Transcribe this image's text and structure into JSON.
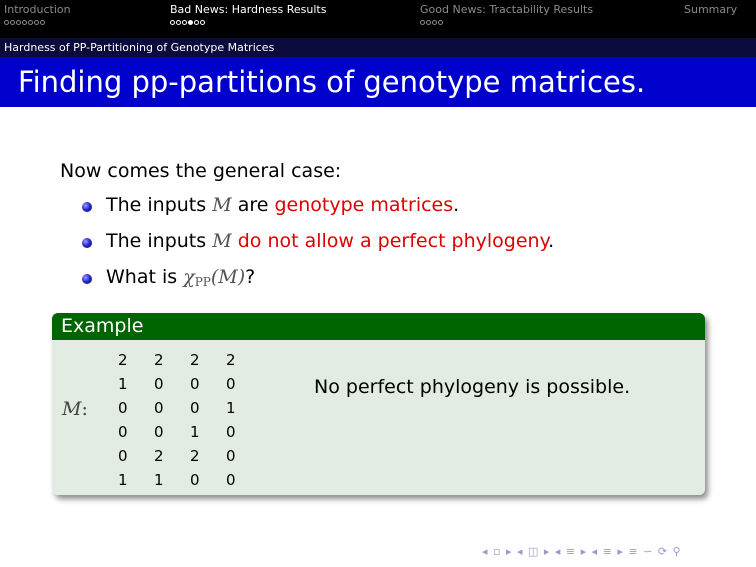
{
  "nav": {
    "sections": [
      {
        "label": "Introduction",
        "dots": 7,
        "filled": -1
      },
      {
        "label": "Bad News: Hardness Results",
        "dots": 6,
        "filled": 3
      },
      {
        "label": "Good News: Tractability Results",
        "dots": 4,
        "filled": -1
      },
      {
        "label": "Summary",
        "dots": 0,
        "filled": -1
      }
    ],
    "active_section": 1
  },
  "subsection": "Hardness of PP-Partitioning of Genotype Matrices",
  "title": "Finding pp-partitions of genotype matrices.",
  "intro": "Now comes the general case:",
  "bullets": [
    {
      "pre": "The inputs",
      "math": "M",
      "mid": "are",
      "red": "genotype matrices",
      "post": "."
    },
    {
      "pre": "The inputs",
      "math": "M",
      "red": "do not allow a perfect phylogeny",
      "post": "."
    },
    {
      "pre": "What is",
      "math_chi": "χ",
      "math_sub": "PP",
      "math_arg": "(M)",
      "post": "?"
    }
  ],
  "example": {
    "header": "Example",
    "matrix_label": "M",
    "matrix_colon": ":",
    "matrix": [
      [
        "2",
        "2",
        "2",
        "2"
      ],
      [
        "1",
        "0",
        "0",
        "0"
      ],
      [
        "0",
        "0",
        "0",
        "1"
      ],
      [
        "0",
        "0",
        "1",
        "0"
      ],
      [
        "0",
        "2",
        "2",
        "0"
      ],
      [
        "1",
        "1",
        "0",
        "0"
      ]
    ],
    "message": "No perfect phylogeny is possible."
  },
  "colors": {
    "header_bg": "#000000",
    "subbar_bg": "#0a0a3c",
    "title_bg": "#0000cc",
    "highlight": "#dd0000",
    "example_header": "#006400",
    "example_body": "#e2ece2"
  },
  "nav_controls": "◂ ▫ ▸ ◂ ◫ ▸ ◂ ≡ ▸ ◂ ≡ ▸ ≡ ∽ ⟳ ⚲"
}
